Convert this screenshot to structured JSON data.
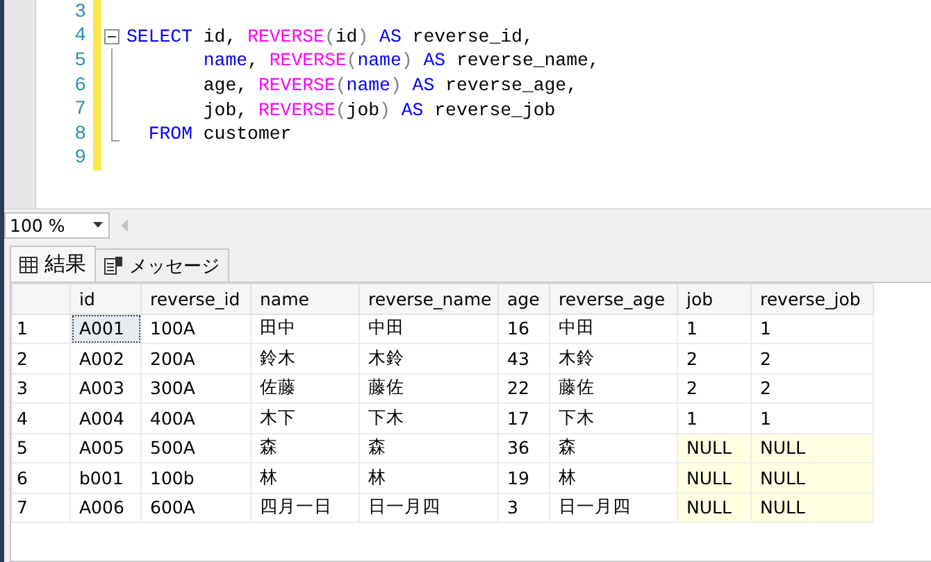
{
  "editor": {
    "lines": [
      {
        "number": "3",
        "kind": "plain"
      },
      {
        "number": "4",
        "kind": "fold_start",
        "tokens": [
          {
            "kind": "keyword",
            "text": "SELECT"
          },
          {
            "kind": "plain",
            "text": " id, "
          },
          {
            "kind": "function",
            "text": "REVERSE"
          },
          {
            "kind": "paren",
            "text": "("
          },
          {
            "kind": "plain",
            "text": "id"
          },
          {
            "kind": "paren",
            "text": ")"
          },
          {
            "kind": "keyword",
            "text": " AS"
          },
          {
            "kind": "plain",
            "text": " reverse_id,"
          }
        ]
      },
      {
        "number": "5",
        "kind": "fold_body",
        "tokens": [
          {
            "kind": "keyword",
            "text": "       name"
          },
          {
            "kind": "plain",
            "text": ", "
          },
          {
            "kind": "function",
            "text": "REVERSE"
          },
          {
            "kind": "paren",
            "text": "("
          },
          {
            "kind": "keyword",
            "text": "name"
          },
          {
            "kind": "paren",
            "text": ")"
          },
          {
            "kind": "keyword",
            "text": " AS"
          },
          {
            "kind": "plain",
            "text": " reverse_name,"
          }
        ]
      },
      {
        "number": "6",
        "kind": "fold_body",
        "tokens": [
          {
            "kind": "plain",
            "text": "       age, "
          },
          {
            "kind": "function",
            "text": "REVERSE"
          },
          {
            "kind": "paren",
            "text": "("
          },
          {
            "kind": "keyword",
            "text": "name"
          },
          {
            "kind": "paren",
            "text": ")"
          },
          {
            "kind": "keyword",
            "text": " AS"
          },
          {
            "kind": "plain",
            "text": " reverse_age,"
          }
        ]
      },
      {
        "number": "7",
        "kind": "fold_body",
        "tokens": [
          {
            "kind": "plain",
            "text": "       job, "
          },
          {
            "kind": "function",
            "text": "REVERSE"
          },
          {
            "kind": "paren",
            "text": "("
          },
          {
            "kind": "plain",
            "text": "job"
          },
          {
            "kind": "paren",
            "text": ")"
          },
          {
            "kind": "keyword",
            "text": " AS"
          },
          {
            "kind": "plain",
            "text": " reverse_job"
          }
        ]
      },
      {
        "number": "8",
        "kind": "fold_end",
        "tokens": [
          {
            "kind": "keyword",
            "text": "  FROM"
          },
          {
            "kind": "plain",
            "text": " customer"
          }
        ]
      },
      {
        "number": "9",
        "kind": "plain"
      }
    ]
  },
  "zoom": {
    "value": "100 %"
  },
  "tabs": [
    {
      "label": "結果",
      "selected": true
    },
    {
      "label": "メッセージ",
      "selected": false
    }
  ],
  "table": {
    "columns": [
      "id",
      "reverse_id",
      "name",
      "reverse_name",
      "age",
      "reverse_age",
      "job",
      "reverse_job"
    ],
    "rows": [
      {
        "number": "1",
        "cells": [
          {
            "text": "A001",
            "null": false,
            "selected": true
          },
          {
            "text": "100A",
            "null": false,
            "selected": false
          },
          {
            "text": "田中",
            "null": false,
            "selected": false
          },
          {
            "text": "中田",
            "null": false,
            "selected": false
          },
          {
            "text": "16",
            "null": false,
            "selected": false
          },
          {
            "text": "中田",
            "null": false,
            "selected": false
          },
          {
            "text": "1",
            "null": false,
            "selected": false
          },
          {
            "text": "1",
            "null": false,
            "selected": false
          }
        ]
      },
      {
        "number": "2",
        "cells": [
          {
            "text": "A002",
            "null": false,
            "selected": false
          },
          {
            "text": "200A",
            "null": false,
            "selected": false
          },
          {
            "text": "鈴木",
            "null": false,
            "selected": false
          },
          {
            "text": "木鈴",
            "null": false,
            "selected": false
          },
          {
            "text": "43",
            "null": false,
            "selected": false
          },
          {
            "text": "木鈴",
            "null": false,
            "selected": false
          },
          {
            "text": "2",
            "null": false,
            "selected": false
          },
          {
            "text": "2",
            "null": false,
            "selected": false
          }
        ]
      },
      {
        "number": "3",
        "cells": [
          {
            "text": "A003",
            "null": false,
            "selected": false
          },
          {
            "text": "300A",
            "null": false,
            "selected": false
          },
          {
            "text": "佐藤",
            "null": false,
            "selected": false
          },
          {
            "text": "藤佐",
            "null": false,
            "selected": false
          },
          {
            "text": "22",
            "null": false,
            "selected": false
          },
          {
            "text": "藤佐",
            "null": false,
            "selected": false
          },
          {
            "text": "2",
            "null": false,
            "selected": false
          },
          {
            "text": "2",
            "null": false,
            "selected": false
          }
        ]
      },
      {
        "number": "4",
        "cells": [
          {
            "text": "A004",
            "null": false,
            "selected": false
          },
          {
            "text": "400A",
            "null": false,
            "selected": false
          },
          {
            "text": "木下",
            "null": false,
            "selected": false
          },
          {
            "text": "下木",
            "null": false,
            "selected": false
          },
          {
            "text": "17",
            "null": false,
            "selected": false
          },
          {
            "text": "下木",
            "null": false,
            "selected": false
          },
          {
            "text": "1",
            "null": false,
            "selected": false
          },
          {
            "text": "1",
            "null": false,
            "selected": false
          }
        ]
      },
      {
        "number": "5",
        "cells": [
          {
            "text": "A005",
            "null": false,
            "selected": false
          },
          {
            "text": "500A",
            "null": false,
            "selected": false
          },
          {
            "text": "森",
            "null": false,
            "selected": false
          },
          {
            "text": "森",
            "null": false,
            "selected": false
          },
          {
            "text": "36",
            "null": false,
            "selected": false
          },
          {
            "text": "森",
            "null": false,
            "selected": false
          },
          {
            "text": "NULL",
            "null": true,
            "selected": false
          },
          {
            "text": "NULL",
            "null": true,
            "selected": false
          }
        ]
      },
      {
        "number": "6",
        "cells": [
          {
            "text": "b001",
            "null": false,
            "selected": false
          },
          {
            "text": "100b",
            "null": false,
            "selected": false
          },
          {
            "text": "林",
            "null": false,
            "selected": false
          },
          {
            "text": "林",
            "null": false,
            "selected": false
          },
          {
            "text": "19",
            "null": false,
            "selected": false
          },
          {
            "text": "林",
            "null": false,
            "selected": false
          },
          {
            "text": "NULL",
            "null": true,
            "selected": false
          },
          {
            "text": "NULL",
            "null": true,
            "selected": false
          }
        ]
      },
      {
        "number": "7",
        "cells": [
          {
            "text": "A006",
            "null": false,
            "selected": false
          },
          {
            "text": "600A",
            "null": false,
            "selected": false
          },
          {
            "text": "四月一日",
            "null": false,
            "selected": false
          },
          {
            "text": "日一月四",
            "null": false,
            "selected": false
          },
          {
            "text": "3",
            "null": false,
            "selected": false
          },
          {
            "text": "日一月四",
            "null": false,
            "selected": false
          },
          {
            "text": "NULL",
            "null": true,
            "selected": false
          },
          {
            "text": "NULL",
            "null": true,
            "selected": false
          }
        ]
      }
    ]
  }
}
